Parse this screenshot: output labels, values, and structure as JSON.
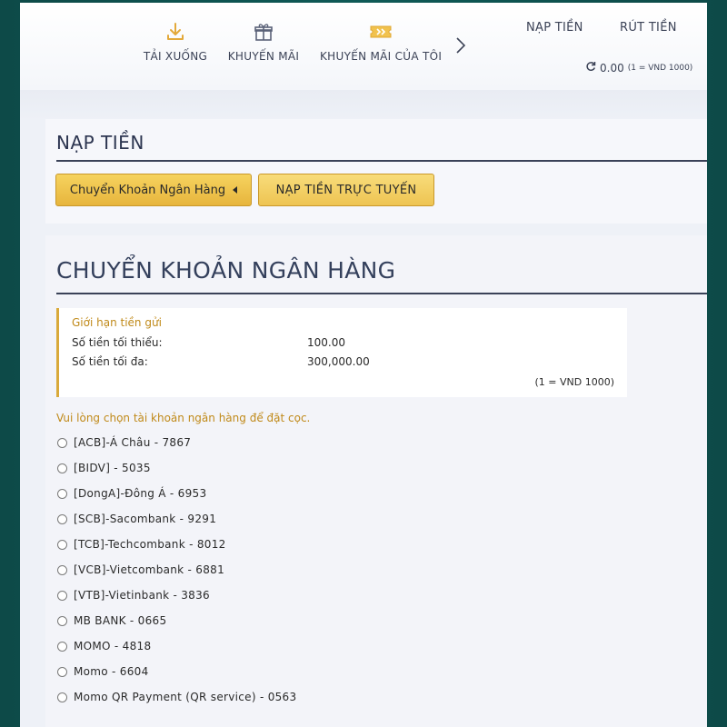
{
  "header": {
    "nav": [
      {
        "label": "TẢI XUỐNG",
        "icon": "download-icon"
      },
      {
        "label": "KHUYẾN MÃI",
        "icon": "gift-icon"
      },
      {
        "label": "KHUYẾN MÃI CỦA TÔI",
        "icon": "ticket-icon"
      }
    ],
    "deposit_link": "NẠP TIỀN",
    "withdraw_link": "RÚT TIỀN",
    "balance": "0.00",
    "balance_rate": "(1 = VND 1000)"
  },
  "deposit": {
    "title": "NẠP TIỀN",
    "tabs": [
      {
        "label": "Chuyển Khoản Ngân Hàng"
      },
      {
        "label": "NẠP TIỀN TRỰC TUYẾN"
      }
    ]
  },
  "bank_transfer": {
    "title": "CHUYỂN KHOẢN NGÂN HÀNG",
    "limits": {
      "title": "Giới hạn tiền gửi",
      "min_label": "Số tiền tối thiểu:",
      "min_value": "100.00",
      "max_label": "Số tiền tối đa:",
      "max_value": "300,000.00",
      "rate": "(1 = VND 1000)"
    },
    "prompt": "Vui lòng chọn tài khoản ngân hàng để đặt cọc.",
    "banks": [
      "[ACB]-Á Châu - 7867",
      "[BIDV] - 5035",
      "[DongA]-Đông Á - 6953",
      "[SCB]-Sacombank - 9291",
      "[TCB]-Techcombank - 8012",
      "[VCB]-Vietcombank - 6881",
      "[VTB]-Vietinbank - 3836",
      "MB BANK - 0665",
      "MOMO - 4818",
      "Momo - 6604",
      "Momo QR Payment (QR service) - 0563"
    ]
  },
  "colors": {
    "gold": "#e7b53d",
    "accent_text": "#c08a1a",
    "heading": "#34405c",
    "background": "#0f5a57"
  }
}
